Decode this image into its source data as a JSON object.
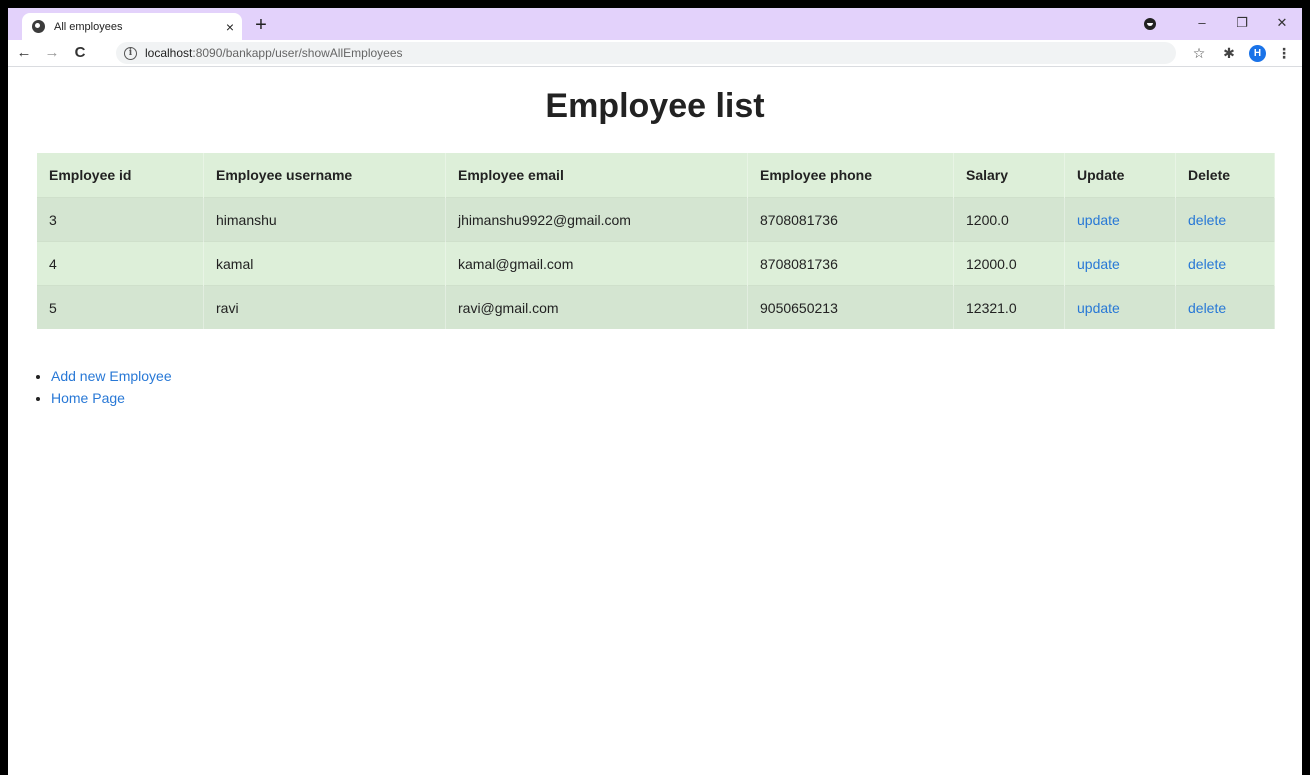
{
  "browser": {
    "tab_title": "All employees",
    "tab_close": "×",
    "new_tab": "+",
    "url_host": "localhost",
    "url_rest": ":8090/bankapp/user/showAllEmployees",
    "avatar_letter": "H",
    "window_controls": {
      "minimize": "–",
      "restore": "❐",
      "close": "✕"
    },
    "icons": [
      "favicon-globe",
      "close-icon",
      "plus-icon",
      "back-icon",
      "forward-icon",
      "reload-icon",
      "info-icon",
      "star-icon",
      "extensions-icon",
      "menu-icon"
    ]
  },
  "page": {
    "title": "Employee list",
    "table": {
      "headers": [
        "Employee id",
        "Employee username",
        "Employee email",
        "Employee phone",
        "Salary",
        "Update",
        "Delete"
      ],
      "rows": [
        {
          "id": "3",
          "username": "himanshu",
          "email": "jhimanshu9922@gmail.com",
          "phone": "8708081736",
          "salary": "1200.0",
          "update": "update",
          "delete": "delete"
        },
        {
          "id": "4",
          "username": "kamal",
          "email": "kamal@gmail.com",
          "phone": "8708081736",
          "salary": "12000.0",
          "update": "update",
          "delete": "delete"
        },
        {
          "id": "5",
          "username": "ravi",
          "email": "ravi@gmail.com",
          "phone": "9050650213",
          "salary": "12321.0",
          "update": "update",
          "delete": "delete"
        }
      ]
    },
    "links": [
      "Add new Employee",
      "Home Page"
    ]
  },
  "colors": {
    "tabstrip": "#e3d2fb",
    "table_header": "#ddefd9",
    "row_odd": "#d4e5d1",
    "row_even": "#ddefd9",
    "link": "#2878d6"
  }
}
